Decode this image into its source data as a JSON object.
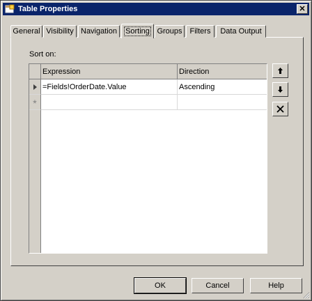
{
  "window": {
    "title": "Table Properties"
  },
  "tabs": [
    {
      "label": "General"
    },
    {
      "label": "Visibility"
    },
    {
      "label": "Navigation"
    },
    {
      "label": "Sorting",
      "active": true
    },
    {
      "label": "Groups"
    },
    {
      "label": "Filters"
    },
    {
      "label": "Data Output"
    }
  ],
  "sorting": {
    "label": "Sort on:",
    "columns": {
      "expression": "Expression",
      "direction": "Direction"
    },
    "rows": [
      {
        "expression": "=Fields!OrderDate.Value",
        "direction": "Ascending"
      }
    ],
    "new_row_marker": "*"
  },
  "side_buttons": [
    "arrow-up-icon",
    "arrow-down-icon",
    "delete-x-icon"
  ],
  "buttons": {
    "ok": "OK",
    "cancel": "Cancel",
    "help": "Help"
  }
}
